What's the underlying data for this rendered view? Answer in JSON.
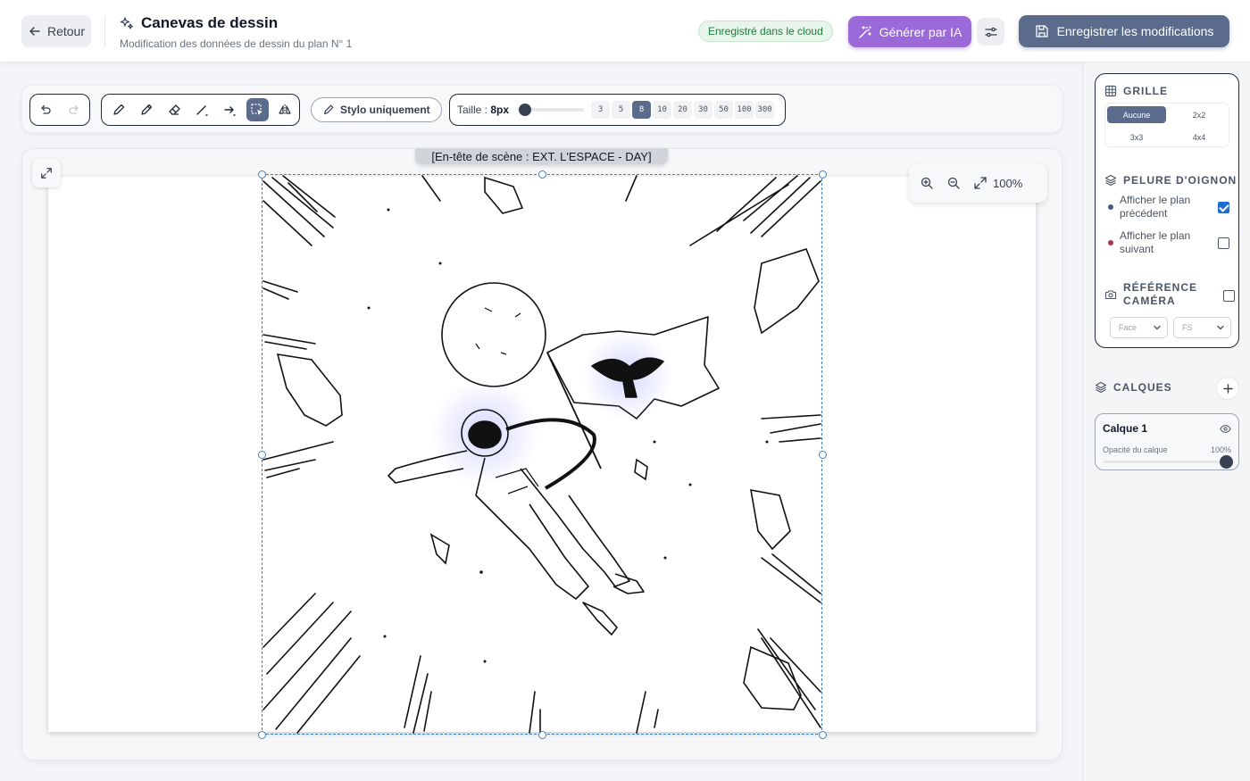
{
  "header": {
    "back_label": "Retour",
    "title": "Canevas de dessin",
    "subtitle": "Modification des données de dessin du plan N° 1",
    "cloud_status": "Enregistré dans le cloud",
    "ai_button": "Générer par IA",
    "save_button": "Enregistrer les modifications"
  },
  "toolbar": {
    "history_icons": [
      "undo-icon",
      "redo-icon"
    ],
    "tools": [
      {
        "name": "pencil-icon",
        "active": false
      },
      {
        "name": "pen-icon",
        "active": false
      },
      {
        "name": "eraser-icon",
        "active": false
      },
      {
        "name": "line-icon",
        "active": false
      },
      {
        "name": "arrow-icon",
        "active": false
      },
      {
        "name": "select-icon",
        "active": true
      },
      {
        "name": "flip-icon",
        "active": false
      }
    ],
    "pen_only_label": "Stylo uniquement",
    "size_label": "Taille : ",
    "size_value": "8px",
    "size_slider_fraction": 0.02,
    "size_options": [
      "3",
      "5",
      "8",
      "10",
      "20",
      "30",
      "50",
      "100",
      "300"
    ],
    "size_selected": "8"
  },
  "canvas": {
    "scene_header": "[En-tête de scène : EXT. L'ESPACE - DAY]",
    "zoom_level": "100%"
  },
  "settings": {
    "grid": {
      "title": "GRILLE",
      "options": [
        "Aucune",
        "2x2",
        "3x3",
        "4x4"
      ],
      "selected": "Aucune"
    },
    "onion": {
      "title": "PELURE D'OIGNON",
      "items": [
        {
          "label": "Afficher le plan précédent",
          "dot_color": "#3f5a86",
          "checked": true
        },
        {
          "label": "Afficher le plan suivant",
          "dot_color": "#b0344a",
          "checked": false
        }
      ]
    },
    "camera": {
      "title": "RÉFÉRENCE CAMÉRA",
      "checked": false,
      "angle_value": "Face",
      "shot_value": "FS"
    }
  },
  "layers": {
    "title": "CALQUES",
    "items": [
      {
        "name": "Calque 1",
        "opacity_label": "Opacité du calque",
        "opacity_value": "100%",
        "opacity_fraction": 1.0
      }
    ]
  },
  "colors": {
    "accent": "#5b6b8c",
    "ai": "#9c6ad8",
    "success_bg": "#e7f5ea",
    "success_text": "#1f7a3a",
    "selection": "#3b82c4"
  }
}
